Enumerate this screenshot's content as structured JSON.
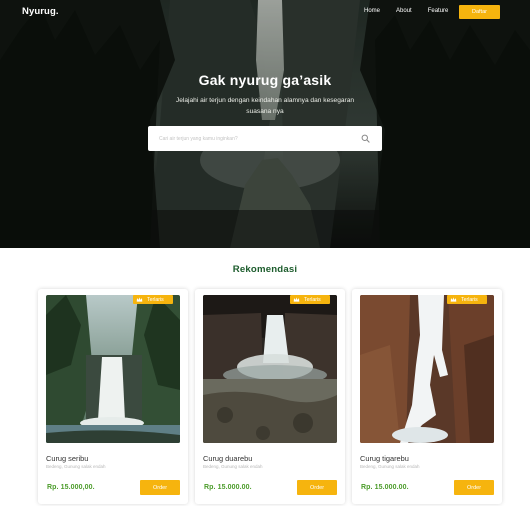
{
  "nav": {
    "logo": "Nyurug.",
    "links": [
      "Home",
      "About",
      "Feature"
    ],
    "cta": "Daftar"
  },
  "hero": {
    "title": "Gak nyurug ga’asik",
    "subtitle": "Jelajahi air terjun dengan keindahan alamnya dan kesegaran suasana nya",
    "search_placeholder": "Cari air terjun yang kamu inginkan?"
  },
  "recommend": {
    "title": "Rekomendasi",
    "cards": [
      {
        "name": "Curug seribu",
        "location": "Bedeng, Gunung salak endah",
        "price": "Rp. 15.000,00.",
        "badge": "Terlaris",
        "button": "Order"
      },
      {
        "name": "Curug duarebu",
        "location": "Bedeng, Gunung salak endah",
        "price": "Rp. 15.000.00.",
        "badge": "Terlaris",
        "button": "Order"
      },
      {
        "name": "Curug tigarebu",
        "location": "Bedeng, Gunung salak endah",
        "price": "Rp. 15.000.00.",
        "badge": "Terlaris",
        "button": "Order"
      }
    ]
  },
  "colors": {
    "accent": "#f6b40e",
    "heading_green": "#1c5c2c",
    "price_green": "#4b9c2a"
  },
  "icons": {
    "search": "search-icon",
    "badge": "crown-icon"
  }
}
